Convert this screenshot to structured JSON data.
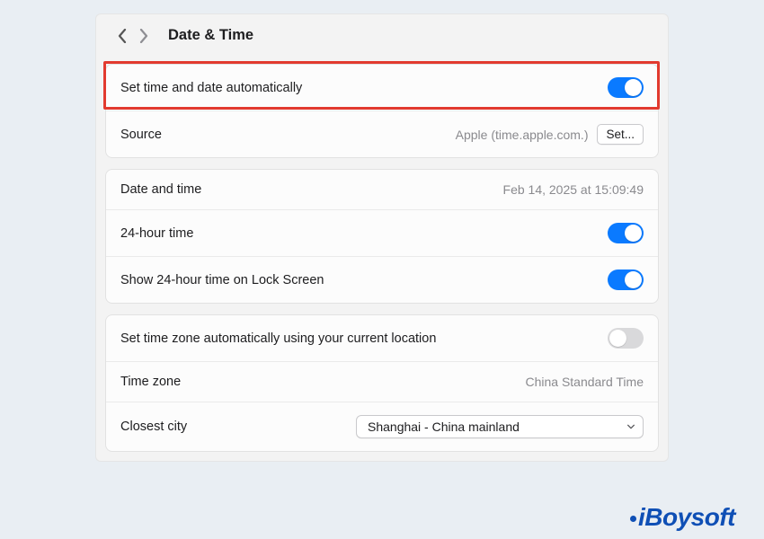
{
  "header": {
    "title": "Date & Time"
  },
  "section1": {
    "autoSet": {
      "label": "Set time and date automatically",
      "on": true
    },
    "source": {
      "label": "Source",
      "value": "Apple (time.apple.com.)",
      "button": "Set..."
    }
  },
  "section2": {
    "dateTime": {
      "label": "Date and time",
      "value": "Feb 14, 2025 at 15:09:49"
    },
    "hour24": {
      "label": "24-hour time",
      "on": true
    },
    "lock24": {
      "label": "Show 24-hour time on Lock Screen",
      "on": true
    }
  },
  "section3": {
    "autoZone": {
      "label": "Set time zone automatically using your current location",
      "on": false
    },
    "timeZone": {
      "label": "Time zone",
      "value": "China Standard Time"
    },
    "closestCity": {
      "label": "Closest city",
      "value": "Shanghai - China mainland"
    }
  },
  "watermark": "iBoysoft"
}
